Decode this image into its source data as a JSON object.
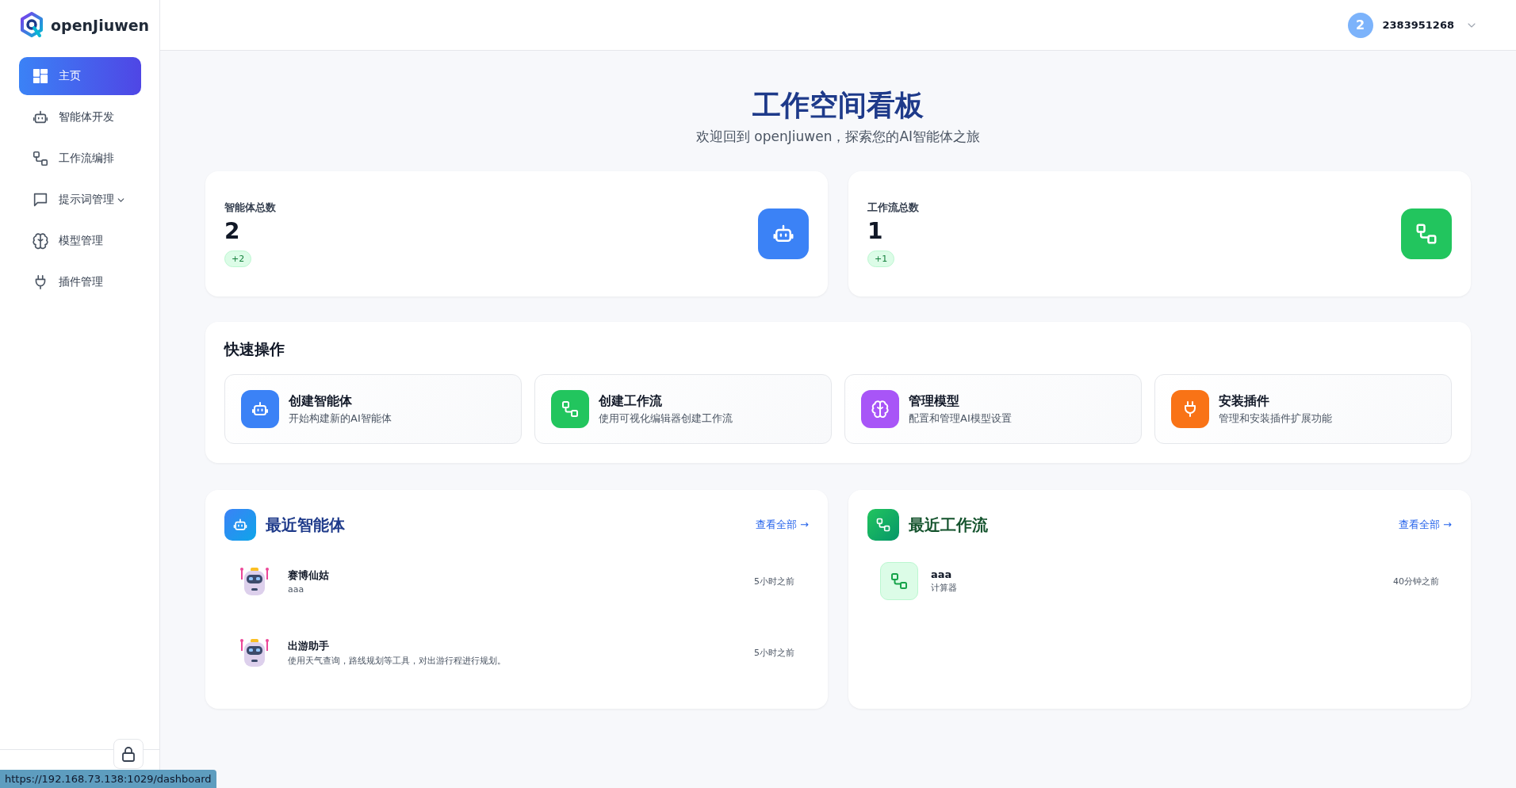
{
  "brand": "openJiuwen",
  "sidebar": {
    "items": [
      {
        "label": "主页",
        "kind": "link",
        "selected": true
      },
      {
        "label": "智能体开发",
        "kind": "link",
        "selected": false
      },
      {
        "label": "工作流编排",
        "kind": "link",
        "selected": false
      },
      {
        "label": "提示词管理",
        "kind": "group",
        "selected": false
      },
      {
        "label": "模型管理",
        "kind": "link",
        "selected": false
      },
      {
        "label": "插件管理",
        "kind": "link",
        "selected": false
      }
    ]
  },
  "user": {
    "avatar": "2",
    "name": "2383951268"
  },
  "header": {
    "title": "工作空间看板",
    "subtitle": "欢迎回到 openJiuwen，探索您的AI智能体之旅"
  },
  "stats": [
    {
      "label": "智能体总数",
      "value": "2",
      "delta": "+2",
      "color": "#3b82f6"
    },
    {
      "label": "工作流总数",
      "value": "1",
      "delta": "+1",
      "color": "#22c55e"
    }
  ],
  "quick_actions": {
    "title": "快速操作",
    "items": [
      {
        "title": "创建智能体",
        "description": "开始构建新的AI智能体",
        "color": "#3b82f6"
      },
      {
        "title": "创建工作流",
        "description": "使用可视化编辑器创建工作流",
        "color": "#22c55e"
      },
      {
        "title": "管理模型",
        "description": "配置和管理AI模型设置",
        "color": "#a855f7"
      },
      {
        "title": "安装插件",
        "description": "管理和安装插件扩展功能",
        "color": "#f97316"
      }
    ]
  },
  "recent": [
    {
      "kind": "agents",
      "title": "最近智能体",
      "link": "查看全部 →",
      "items": [
        {
          "name": "赛博仙姑",
          "description": "aaa",
          "time": "5小时之前"
        },
        {
          "name": "出游助手",
          "description": "使用天气查询，路线规划等工具，对出游行程进行规划。",
          "time": "5小时之前"
        }
      ]
    },
    {
      "kind": "workflows",
      "title": "最近工作流",
      "link": "查看全部 →",
      "items": [
        {
          "name": "aaa",
          "description": "计算器",
          "time": "40分钟之前"
        }
      ]
    }
  ],
  "status_url": "https://192.168.73.138:1029/dashboard"
}
